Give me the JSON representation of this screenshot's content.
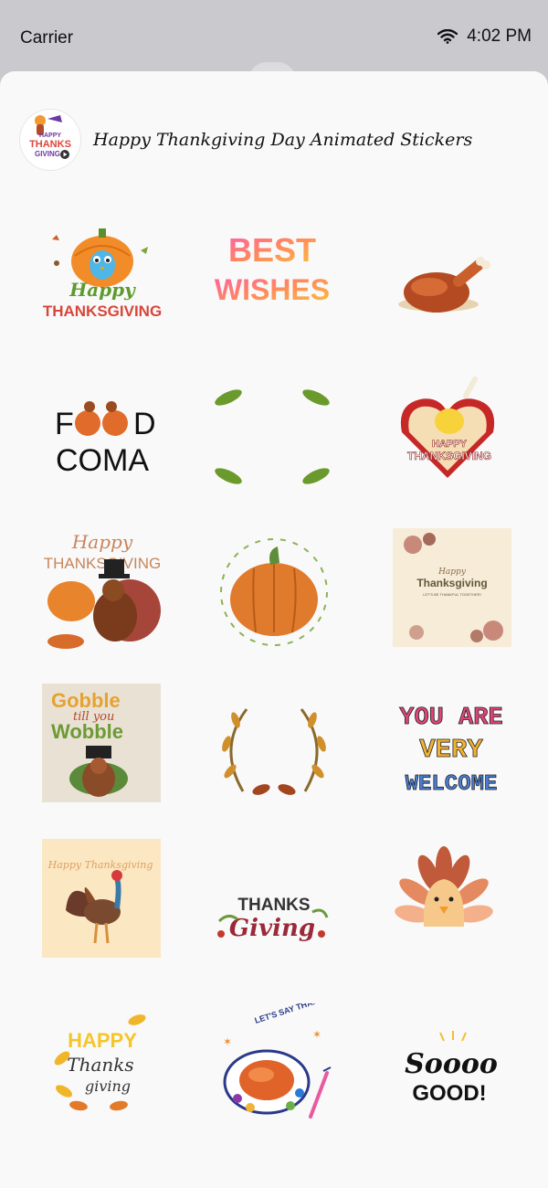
{
  "status_bar": {
    "carrier": "Carrier",
    "time": "4:02 PM",
    "wifi_icon": "wifi-icon"
  },
  "pack": {
    "title": "Happy Thankgiving Day Animated Stickers",
    "icon_text_top": "HAPPY",
    "icon_text_mid": "THANKS",
    "icon_text_bot": "GIVING"
  },
  "stickers": [
    {
      "name": "happy-thanksgiving-bird",
      "l1": "Happy",
      "l2": "THANKSGIVING"
    },
    {
      "name": "best-wishes",
      "l1": "BEST",
      "l2": "WISHES"
    },
    {
      "name": "roast-turkey"
    },
    {
      "name": "food-coma",
      "l1": "F",
      "l2": "D",
      "l3": "COMA"
    },
    {
      "name": "leaf-frame"
    },
    {
      "name": "happy-thanksgiving-badge",
      "l1": "HAPPY",
      "l2": "THANKSGIVING"
    },
    {
      "name": "pilgrim-turkey",
      "l1": "Happy",
      "l2": "THANKSGIVING"
    },
    {
      "name": "pumpkin-wreath"
    },
    {
      "name": "thanksgiving-floral-card",
      "l1": "Happy",
      "l2": "Thanksgiving",
      "l3": "LET'S BE THANKFUL TOGETHER!"
    },
    {
      "name": "gobble-till-you-wobble",
      "l1": "Gobble",
      "l2": "till you",
      "l3": "Wobble"
    },
    {
      "name": "autumn-wreath"
    },
    {
      "name": "you-are-very-welcome",
      "l1": "YOU ARE",
      "l2": "VERY",
      "l3": "WELCOME"
    },
    {
      "name": "happy-thanksgiving-turkey-card",
      "l1": "Happy Thanksgiving"
    },
    {
      "name": "thanks-giving-lettering",
      "l1": "THANKS",
      "l2": "Giving"
    },
    {
      "name": "cartoon-turkey"
    },
    {
      "name": "happy-thanks-giving-leaves",
      "l1": "HAPPY",
      "l2": "Thanks",
      "l3": "giving"
    },
    {
      "name": "lets-say-thanks",
      "l1": "LET'S SAY THANKS!"
    },
    {
      "name": "soooo-good",
      "l1": "Soooo",
      "l2": "GOOD!"
    }
  ]
}
